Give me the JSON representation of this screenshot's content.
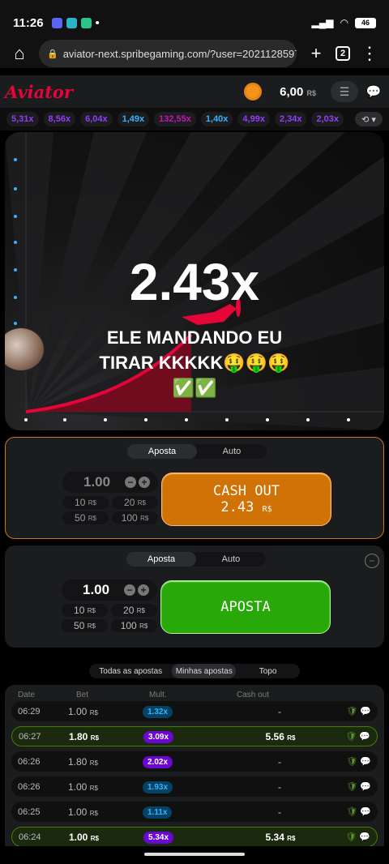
{
  "status": {
    "time": "11:26",
    "battery": "46"
  },
  "browser": {
    "url": "aviator-next.spribegaming.com/?user=2021128597497&",
    "tabs": "2"
  },
  "header": {
    "logo": "Aviator",
    "balance": "6,00",
    "currency": "R$"
  },
  "history": [
    "5,31x",
    "8,56x",
    "6,04x",
    "1,49x",
    "132,55x",
    "1,40x",
    "4,99x",
    "2,34x",
    "2,03x"
  ],
  "history_colors": [
    "purple",
    "purple",
    "purple",
    "blue",
    "pink",
    "blue",
    "purple",
    "purple",
    "purple"
  ],
  "game": {
    "multiplier": "2.43x",
    "overlay_line1": "ELE MANDANDO EU",
    "overlay_line2": "TIRAR KKKKK🤑🤑🤑",
    "overlay_line3": "✅✅"
  },
  "bet1": {
    "tab_bet": "Aposta",
    "tab_auto": "Auto",
    "amount": "1.00",
    "quick": [
      "10",
      "20",
      "50",
      "100"
    ],
    "button_title": "CASH OUT",
    "button_value": "2.43",
    "button_currency": "R$"
  },
  "bet2": {
    "tab_bet": "Aposta",
    "tab_auto": "Auto",
    "amount": "1.00",
    "quick": [
      "10",
      "20",
      "50",
      "100"
    ],
    "button_title": "APOSTA"
  },
  "bets_tabs": [
    "Todas as apostas",
    "Minhas apostas",
    "Topo"
  ],
  "bets_columns": [
    "Date",
    "Bet",
    "Mult.",
    "Cash out"
  ],
  "bets": [
    {
      "date": "06:29",
      "bet": "1.00",
      "mult": "1.32x",
      "cash": "-",
      "win": false,
      "color": "blue"
    },
    {
      "date": "06:27",
      "bet": "1.80",
      "mult": "3.09x",
      "cash": "5.56",
      "win": true,
      "color": "purple"
    },
    {
      "date": "06:26",
      "bet": "1.80",
      "mult": "2.02x",
      "cash": "-",
      "win": false,
      "color": "purple"
    },
    {
      "date": "06:26",
      "bet": "1.00",
      "mult": "1.93x",
      "cash": "-",
      "win": false,
      "color": "blue"
    },
    {
      "date": "06:25",
      "bet": "1.00",
      "mult": "1.11x",
      "cash": "-",
      "win": false,
      "color": "blue"
    },
    {
      "date": "06:24",
      "bet": "1.00",
      "mult": "5.34x",
      "cash": "5.34",
      "win": true,
      "color": "purple"
    }
  ],
  "colors": {
    "accent": "#e50539",
    "cashout": "#d07206",
    "bet": "#28a909"
  }
}
